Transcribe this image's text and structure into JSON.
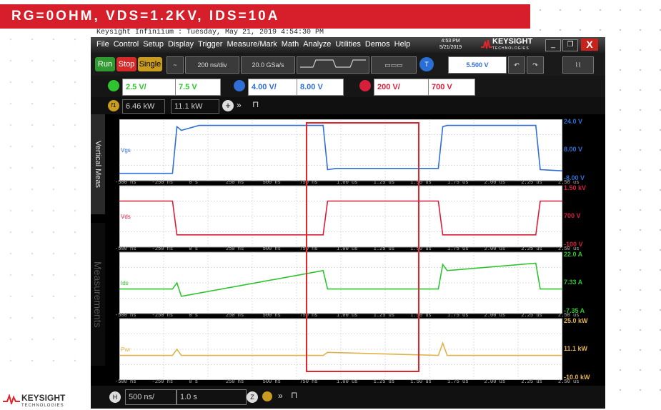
{
  "slide": {
    "title": "RG=0OHM, VDS=1.2KV, IDS=10A",
    "caption": "Keysight Infiniium : Tuesday, May 21, 2019 4:54:30 PM",
    "logo_name": "KEYSIGHT",
    "logo_sub": "TECHNOLOGIES"
  },
  "window": {
    "menu": [
      "File",
      "Control",
      "Setup",
      "Display",
      "Trigger",
      "Measure/Mark",
      "Math",
      "Analyze",
      "Utilities",
      "Demos",
      "Help"
    ],
    "clock_time": "4:53 PM",
    "clock_date": "5/21/2019",
    "brand": "KEYSIGHT",
    "brand_sub": "TECHNOLOGIES",
    "close": "X"
  },
  "toolbar": {
    "run": "Run",
    "stop": "Stop",
    "single": "Single",
    "timebase": "200 ns/div",
    "sample_rate": "20.0 GSa/s",
    "trigger_level": "5.500 V",
    "trigger_icon": "T"
  },
  "channels": [
    {
      "id": "1",
      "scale": "2.5 V/",
      "offset": "7.5 V",
      "color": "#2fc42f"
    },
    {
      "id": "2",
      "scale": "4.00 V/",
      "offset": "8.00 V",
      "color": "#2f6fd6"
    },
    {
      "id": "4",
      "scale": "200 V/",
      "offset": "700 V",
      "color": "#d61f3b"
    }
  ],
  "mathbar": {
    "func": "f1",
    "value1": "6.46 kW",
    "value2": "11.1 kW"
  },
  "sidetabs": {
    "vertical": "Vertical Meas",
    "measurements": "Measurements"
  },
  "panels": [
    {
      "name": "vgs",
      "label": "Vgs",
      "color": "#2f6fd6",
      "scale_top": "24.0 V",
      "scale_mid": "8.00 V",
      "scale_bot": "-8.00 V"
    },
    {
      "name": "vds",
      "label": "Vds",
      "color": "#d61f3b",
      "scale_top": "1.50 kV",
      "scale_mid": "700 V",
      "scale_bot": "-100 V"
    },
    {
      "name": "ids",
      "label": "Ids",
      "color": "#2fc42f",
      "scale_top": "22.0 A",
      "scale_mid": "7.33 A",
      "scale_bot": "-7.35 A"
    },
    {
      "name": "power",
      "label": "Pwr",
      "color": "#e2b24a",
      "scale_top": "25.0 kW",
      "scale_mid": "11.1 kW",
      "scale_bot": "-10.0 kW"
    }
  ],
  "xticks": [
    "-500 ns",
    "-250 ns",
    "0 s",
    "250 ns",
    "500 ns",
    "750 ns",
    "1.00 us",
    "1.25 us",
    "1.50 us",
    "1.75 us",
    "2.00 us",
    "2.25 us",
    "2.50 us"
  ],
  "bottombar": {
    "h": "H",
    "hscale": "500 ns/",
    "hpos": "1.0 s",
    "z": "Z"
  },
  "highlight_color": "#e3242b"
}
